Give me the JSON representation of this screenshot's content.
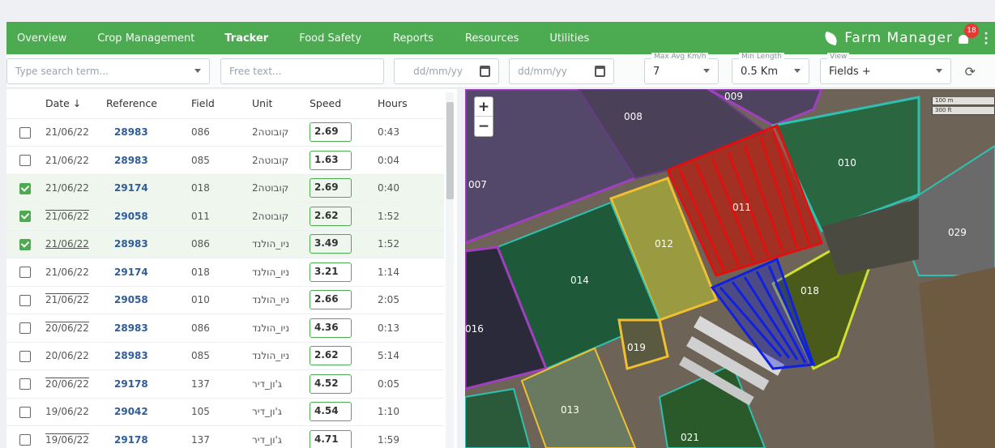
{
  "nav": {
    "items": [
      "Overview",
      "Crop Management",
      "Tracker",
      "Food Safety",
      "Reports",
      "Resources",
      "Utilities"
    ],
    "active": "Tracker",
    "brand": "Farm Manager",
    "notifications": "18"
  },
  "filters": {
    "search_placeholder": "Type search term...",
    "freetext_placeholder": "Free text...",
    "date_from_placeholder": "dd/mm/yy",
    "date_to_placeholder": "dd/mm/yy",
    "max_avg_label": "Max Avg Km/h",
    "max_avg_value": "7",
    "min_length_label": "Min Length",
    "min_length_value": "0.5 Km",
    "view_label": "View",
    "view_value": "Fields +"
  },
  "table": {
    "columns": [
      "Date ↓",
      "Reference",
      "Field",
      "Unit",
      "Speed",
      "Hours"
    ],
    "rows": [
      {
        "checked": false,
        "date": "21/06/22",
        "date_style": "",
        "ref": "28983",
        "field": "086",
        "unit": "2קובוטה",
        "speed": "2.69",
        "hours": "0:43"
      },
      {
        "checked": false,
        "date": "21/06/22",
        "date_style": "",
        "ref": "28983",
        "field": "085",
        "unit": "2קובוטה",
        "speed": "1.63",
        "hours": "0:04"
      },
      {
        "checked": true,
        "date": "21/06/22",
        "date_style": "",
        "ref": "29174",
        "field": "018",
        "unit": "2קובוטה",
        "speed": "2.69",
        "hours": "0:40"
      },
      {
        "checked": true,
        "date": "21/06/22",
        "date_style": "ol",
        "ref": "29058",
        "field": "011",
        "unit": "2קובוטה",
        "speed": "2.62",
        "hours": "1:52"
      },
      {
        "checked": true,
        "date": "21/06/22",
        "date_style": "ul",
        "ref": "28983",
        "field": "086",
        "unit": "ניו_הולנד",
        "speed": "3.49",
        "hours": "1:52"
      },
      {
        "checked": false,
        "date": "21/06/22",
        "date_style": "",
        "ref": "29174",
        "field": "018",
        "unit": "ניו_הולנד",
        "speed": "3.21",
        "hours": "1:14"
      },
      {
        "checked": false,
        "date": "21/06/22",
        "date_style": "ol",
        "ref": "29058",
        "field": "010",
        "unit": "ניו_הולנד",
        "speed": "2.66",
        "hours": "2:05"
      },
      {
        "checked": false,
        "date": "20/06/22",
        "date_style": "ol",
        "ref": "28983",
        "field": "086",
        "unit": "ניו_הולנד",
        "speed": "4.36",
        "hours": "0:13"
      },
      {
        "checked": false,
        "date": "20/06/22",
        "date_style": "",
        "ref": "28983",
        "field": "085",
        "unit": "ניו_הולנד",
        "speed": "2.62",
        "hours": "5:14"
      },
      {
        "checked": false,
        "date": "20/06/22",
        "date_style": "ol",
        "ref": "29178",
        "field": "137",
        "unit": "ג'ון_דיר",
        "speed": "4.52",
        "hours": "0:05"
      },
      {
        "checked": false,
        "date": "19/06/22",
        "date_style": "",
        "ref": "29042",
        "field": "105",
        "unit": "ג'ון_דיר",
        "speed": "4.54",
        "hours": "1:10"
      },
      {
        "checked": false,
        "date": "19/06/22",
        "date_style": "ol",
        "ref": "29178",
        "field": "137",
        "unit": "ג'ון_דיר",
        "speed": "4.71",
        "hours": "1:59"
      }
    ]
  },
  "map": {
    "field_labels": [
      "009",
      "008",
      "007",
      "010",
      "011",
      "012",
      "014",
      "018",
      "029",
      "016",
      "019",
      "013",
      "021"
    ],
    "scale": [
      "100 m",
      "300 ft"
    ]
  },
  "colors": {
    "brand_green": "#4caa50",
    "track_red": "#e01010",
    "track_blue": "#1020e0"
  }
}
